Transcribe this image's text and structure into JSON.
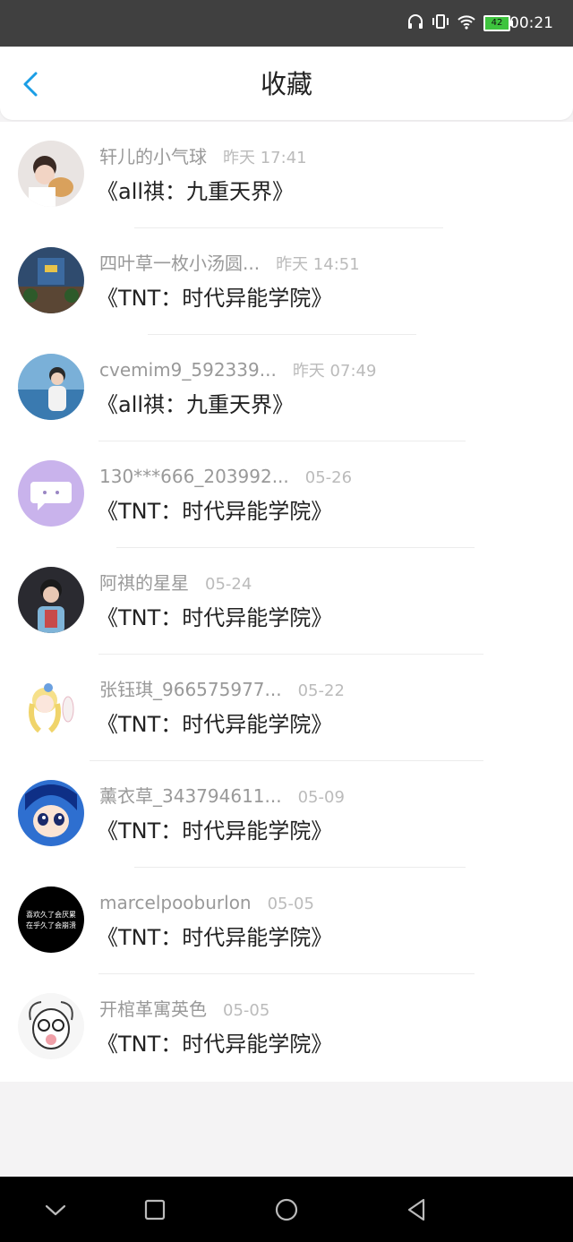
{
  "status": {
    "time": "00:21",
    "battery": "42"
  },
  "header": {
    "title": "收藏"
  },
  "items": [
    {
      "name": "轩儿的小气球",
      "time": "昨天 17:41",
      "work": "《all祺：九重天界》",
      "avatar_color": "#d8d0cc"
    },
    {
      "name": "四叶草一枚小汤圆...",
      "time": "昨天 14:51",
      "work": "《TNT：时代异能学院》",
      "avatar_color": "#2f4b6e"
    },
    {
      "name": "cvemim9_592339...",
      "time": "昨天 07:49",
      "work": "《all祺：九重天界》",
      "avatar_color": "#3a7ab0"
    },
    {
      "name": "130***666_203992...",
      "time": "05-26",
      "work": "《TNT：时代异能学院》",
      "avatar_color": "#c9b3ec"
    },
    {
      "name": "阿祺的星星",
      "time": "05-24",
      "work": "《TNT：时代异能学院》",
      "avatar_color": "#2a2a30"
    },
    {
      "name": "张钰琪_966575977...",
      "time": "05-22",
      "work": "《TNT：时代异能学院》",
      "avatar_color": "#f4ecd8"
    },
    {
      "name": "薰衣草_343794611...",
      "time": "05-09",
      "work": "《TNT：时代异能学院》",
      "avatar_color": "#2e6fd0"
    },
    {
      "name": "marcelpooburlon",
      "time": "05-05",
      "work": "《TNT：时代异能学院》",
      "avatar_color": "#000000",
      "avatar_text": [
        "喜欢久了会厌累",
        "在乎久了会崩溃"
      ]
    },
    {
      "name": "开棺革寓英色",
      "time": "05-05",
      "work": "《TNT：时代异能学院》",
      "avatar_color": "#f6f6f6"
    }
  ],
  "nav": {
    "icons": [
      "chevron-down-icon",
      "square-icon",
      "circle-icon",
      "triangle-back-icon"
    ]
  },
  "colors": {
    "accent": "#1a9ee6",
    "status_bar": "#404040",
    "battery": "#3ec43e"
  }
}
